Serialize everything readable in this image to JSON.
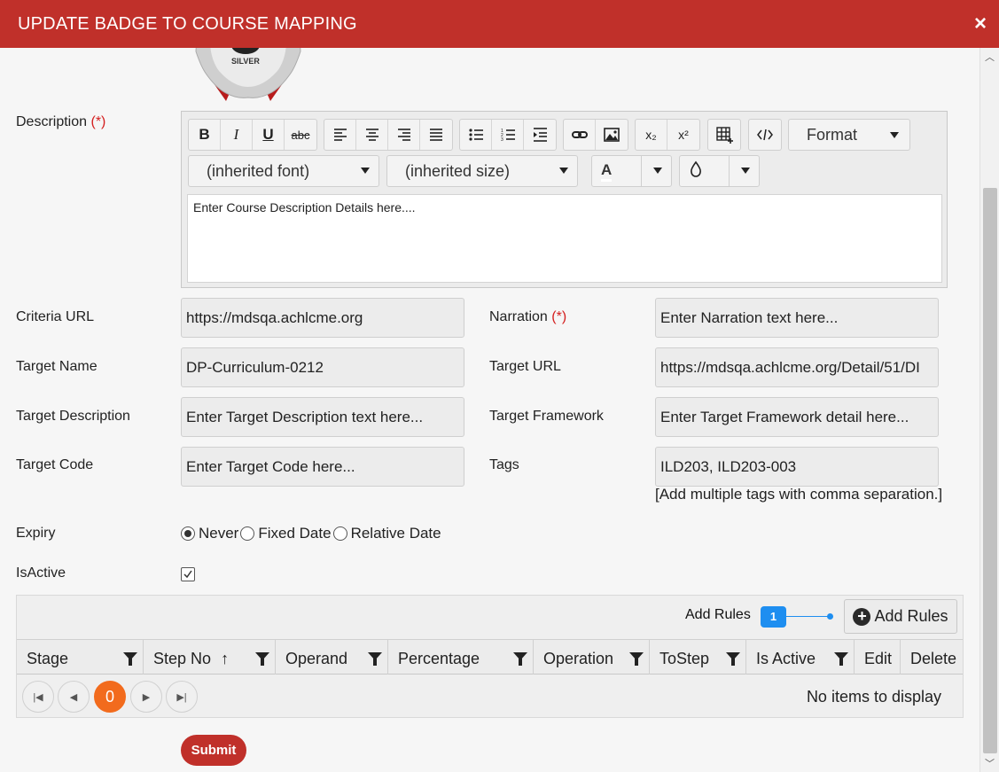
{
  "dialog": {
    "title": "UPDATE BADGE TO COURSE MAPPING",
    "close_glyph": "×"
  },
  "badge": {
    "text": "SILVER"
  },
  "description": {
    "label": "Description",
    "required_mark": "(*)",
    "toolbar": {
      "bold": "B",
      "italic": "I",
      "underline": "U",
      "strike": "abc",
      "subscript": "x₂",
      "superscript": "x²",
      "format": "Format",
      "font": "(inherited font)",
      "size": "(inherited size)",
      "font_color": "A"
    },
    "content": "Enter Course Description Details here...."
  },
  "fields": {
    "criteria_url": {
      "label": "Criteria URL",
      "value": "https://mdsqa.achlcme.org"
    },
    "narration": {
      "label": "Narration",
      "required_mark": "(*)",
      "placeholder": "Enter Narration text here..."
    },
    "target_name": {
      "label": "Target Name",
      "value": "DP-Curriculum-0212"
    },
    "target_url": {
      "label": "Target URL",
      "value": "https://mdsqa.achlcme.org/Detail/51/DI"
    },
    "target_description": {
      "label": "Target Description",
      "placeholder": "Enter Target Description text here..."
    },
    "target_framework": {
      "label": "Target Framework",
      "placeholder": "Enter Target Framework detail here..."
    },
    "target_code": {
      "label": "Target Code",
      "placeholder": "Enter Target Code here..."
    },
    "tags": {
      "label": "Tags",
      "value": "ILD203, ILD203-003",
      "hint": "[Add multiple tags with comma separation.]"
    }
  },
  "expiry": {
    "label": "Expiry",
    "options": [
      "Never",
      "Fixed Date",
      "Relative Date"
    ],
    "selected": "Never"
  },
  "is_active": {
    "label": "IsActive",
    "checked": true
  },
  "rules_grid": {
    "toolbar_label": "Add Rules",
    "count_badge": "1",
    "add_button": "Add Rules",
    "columns": [
      "Stage",
      "Step No",
      "Operand",
      "Percentage",
      "Operation",
      "ToStep",
      "Is Active",
      "Edit",
      "Delete"
    ],
    "sort_indicator": "↑",
    "current_page": "0",
    "empty_message": "No items to display"
  },
  "submit_label": "Submit",
  "colors": {
    "header": "#c0302a",
    "accent_blue": "#1e8ef0",
    "page_orange": "#f26b1d",
    "required": "#d42020"
  }
}
